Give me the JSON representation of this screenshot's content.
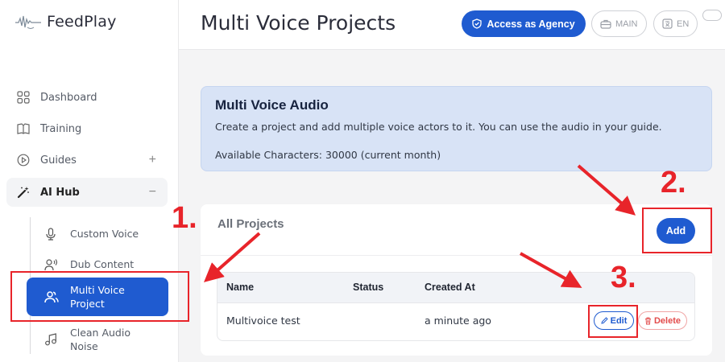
{
  "app": {
    "name": "FeedPlay"
  },
  "sidebar": {
    "items": [
      {
        "label": "Dashboard",
        "icon": "grid-icon"
      },
      {
        "label": "Training",
        "icon": "book-icon"
      },
      {
        "label": "Guides",
        "icon": "play-circle-icon",
        "trail": "+"
      },
      {
        "label": "AI Hub",
        "icon": "magic-wand-icon",
        "trail": "−"
      }
    ],
    "sub_items": [
      {
        "label": "Custom Voice",
        "icon": "microphone-icon"
      },
      {
        "label": "Dub Content",
        "icon": "user-voice-icon"
      },
      {
        "label": "Multi Voice Project",
        "icon": "users-icon"
      },
      {
        "label": "Clean Audio Noise",
        "icon": "music-note-icon"
      }
    ]
  },
  "header": {
    "title": "Multi Voice Projects",
    "agency_button": "Access as Agency",
    "main_pill": "MAIN",
    "lang_pill": "EN"
  },
  "banner": {
    "title": "Multi Voice Audio",
    "description": "Create a project and add multiple voice actors to it. You can use the audio in your guide.",
    "characters": "Available Characters: 30000 (current month)"
  },
  "projects": {
    "title": "All Projects",
    "add_label": "Add",
    "columns": [
      "Name",
      "Status",
      "Created At"
    ],
    "rows": [
      {
        "name": "Multivoice test",
        "status": "",
        "created": "a minute ago",
        "edit": "Edit",
        "delete": "Delete"
      }
    ]
  },
  "annotations": {
    "one": "1.",
    "two": "2.",
    "three": "3."
  },
  "colors": {
    "primary": "#1f5bd0",
    "annotation": "#e8242a",
    "banner": "#d8e3f6",
    "danger": "#e24b4b"
  }
}
